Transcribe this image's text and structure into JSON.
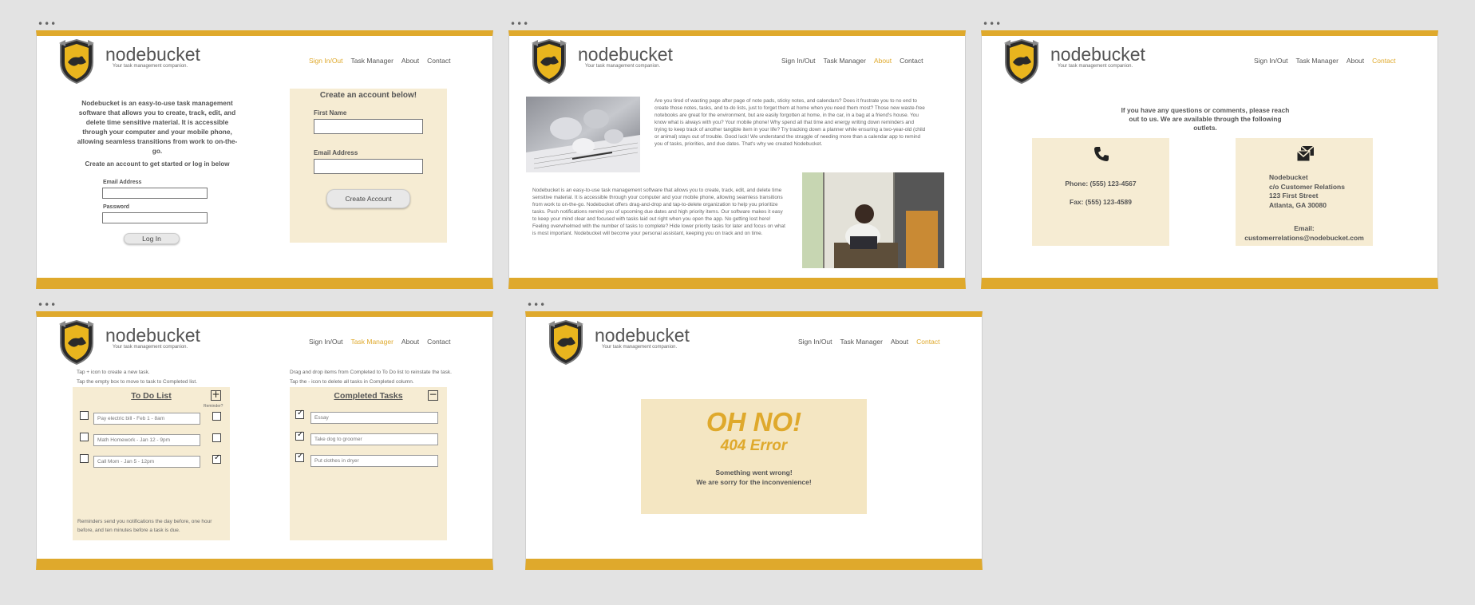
{
  "brand": {
    "name": "nodebucket",
    "tagline": "Your task management companion."
  },
  "nav": {
    "sign": "Sign In/Out",
    "tasks": "Task Manager",
    "about": "About",
    "contact": "Contact"
  },
  "colors": {
    "accent": "#dfa92c",
    "panel": "#f6ecd3",
    "background": "#e3e3e3"
  },
  "icons": [
    "crest-logo-icon",
    "phone-icon",
    "mail-icon",
    "checkbox-icon",
    "plus-icon",
    "minus-icon"
  ],
  "signin": {
    "intro": "Nodebucket is an easy-to-use task management software that allows you to create, track, edit, and delete time sensitive material. It is accessible through your computer and your mobile phone, allowing seamless transitions from work to on-the-go.",
    "prompt": "Create an account to get started or log in below",
    "email_label": "Email Address",
    "password_label": "Password",
    "login_button": "Log In",
    "create_title": "Create an account below!",
    "first_name_label": "First Name",
    "email_label2": "Email Address",
    "create_button": "Create Account"
  },
  "about": {
    "para1": "Are you tired of wasting page after page of note pads, sticky notes, and calendars? Does it frustrate you to no end to create those notes, tasks, and to-do lists, just to forget them at home when you need them most? Those new waste-free notebooks are great for the environment, but are easily forgotten at home, in the car, in a bag at a friend's house. You know what is always with you? Your mobile phone! Why spend all that time and energy writing down reminders and trying to keep track of another tangible item in your life? Try tracking down a planner while ensuring a two-year-old (child or animal) stays out of trouble. Good luck! We understand the struggle of needing more than a calendar app to remind you of tasks, priorities, and due dates. That's why we created Nodebucket.",
    "para2": "Nodebucket is an easy-to-use task management software that allows you to create, track, edit, and delete time sensitive material. It is accessible through your computer and your mobile phone, allowing seamless transitions from work to on-the-go. Nodebucket offers drag-and-drop and tap-to-delete organization to help you prioritize tasks. Push notifications remind you of upcoming due dates and high priority items. Our software makes it easy to keep your mind clear and focused with tasks laid out right when you open the app. No getting lost here! Feeling overwhelmed with the number of tasks to complete? Hide lower priority tasks for later and focus on what is most important. Nodebucket will become your personal assistant, keeping you on track and on time."
  },
  "contact": {
    "intro": "If you have any questions or comments, please reach out to us. We are available through the following outlets.",
    "phone": "Phone: (555) 123-4567",
    "fax": "Fax: (555) 123-4589",
    "addr1": "Nodebucket",
    "addr2": "c/o Customer Relations",
    "addr3": "123 First Street",
    "addr4": "Atlanta, GA 30080",
    "email_label": "Email:",
    "email": "customerrelations@nodebucket.com"
  },
  "tasks": {
    "help1": "Tap + icon to create a new task.",
    "help2": "Tap the empty box to move to task to Completed list.",
    "help3": "Drag and drop items from Completed to To Do list to reinstate the task.",
    "help4": "Tap the - icon to delete all tasks in Completed column.",
    "todo_title": "To Do List",
    "reminder_label": "Reminder?",
    "todo": [
      {
        "text": "Pay electric bill - Feb 1 - 8am",
        "reminder": false
      },
      {
        "text": "Math Homework - Jan 12 - 9pm",
        "reminder": false
      },
      {
        "text": "Call Mom - Jan 5 - 12pm",
        "reminder": true
      }
    ],
    "todo_footer": "Reminders send you notifications the day before, one hour before, and ten minutes before a task is due.",
    "done_title": "Completed Tasks",
    "done": [
      "Essay",
      "Take dog to groomer",
      "Put clothes in dryer"
    ]
  },
  "error": {
    "title": "OH NO!",
    "code": "404 Error",
    "line1": "Something went wrong!",
    "line2": "We are sorry for the inconvenience!"
  }
}
